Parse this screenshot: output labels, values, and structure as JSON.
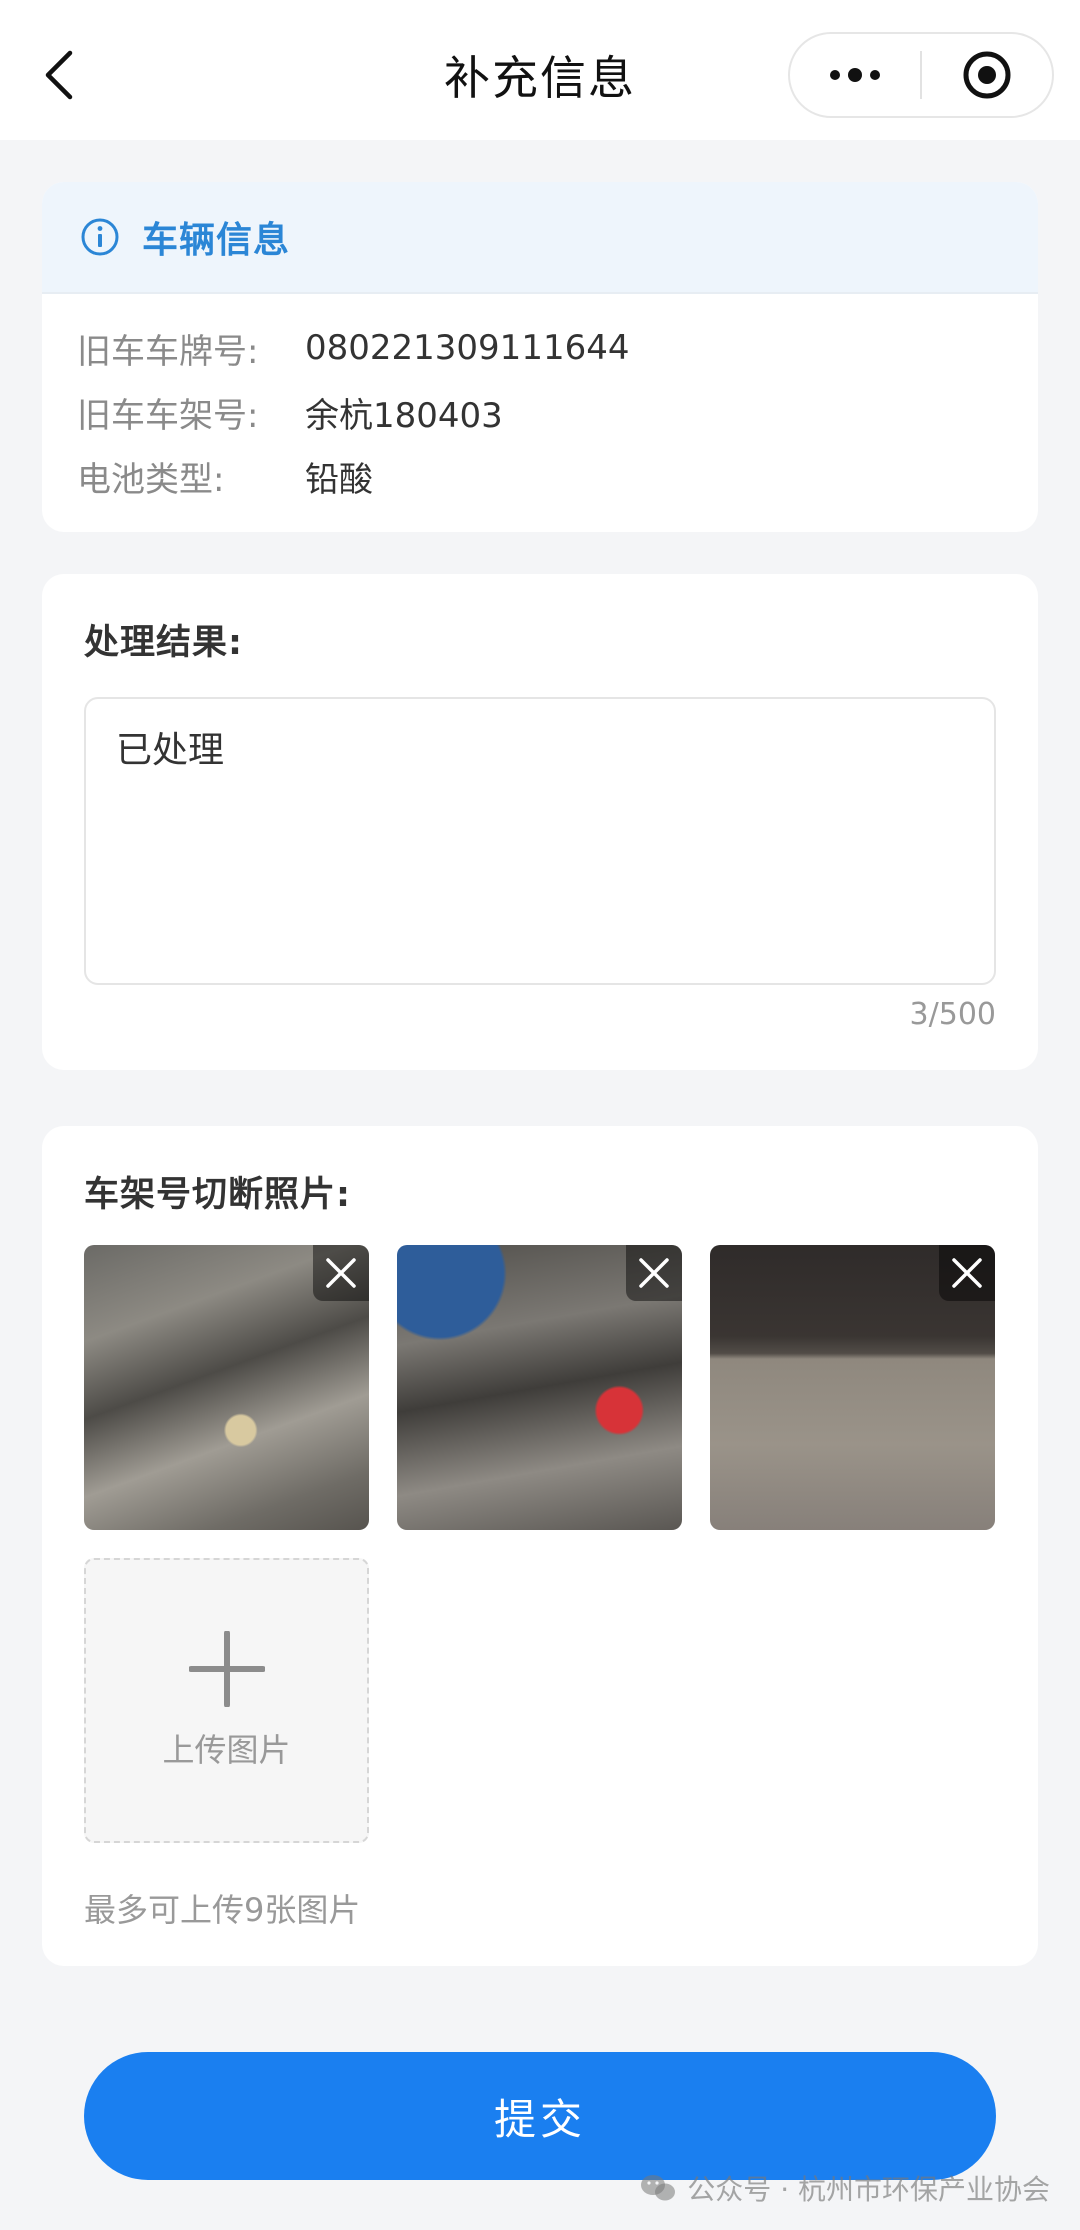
{
  "nav": {
    "title": "补充信息",
    "back_icon": "chevron-left-icon",
    "more_icon": "more-dots-icon",
    "target_icon": "target-icon"
  },
  "vehicle": {
    "section_title": "车辆信息",
    "info_icon": "info-icon",
    "rows": [
      {
        "label": "旧车车牌号:",
        "value": "080221309111644"
      },
      {
        "label": "旧车车架号:",
        "value": "余杭180403"
      },
      {
        "label": "电池类型:",
        "value": "铅酸"
      }
    ]
  },
  "result": {
    "title": "处理结果:",
    "value": "已处理",
    "counter": "3/500"
  },
  "photos": {
    "title": "车架号切断照片:",
    "upload_label": "上传图片",
    "hint": "最多可上传9张图片"
  },
  "submit_label": "提交",
  "watermark": "公众号 · 杭州市环保产业协会",
  "colors": {
    "accent": "#1a7ff0",
    "info_blue": "#2b86d6",
    "header_bg": "#eef5fc",
    "page_bg": "#f4f5f7"
  }
}
